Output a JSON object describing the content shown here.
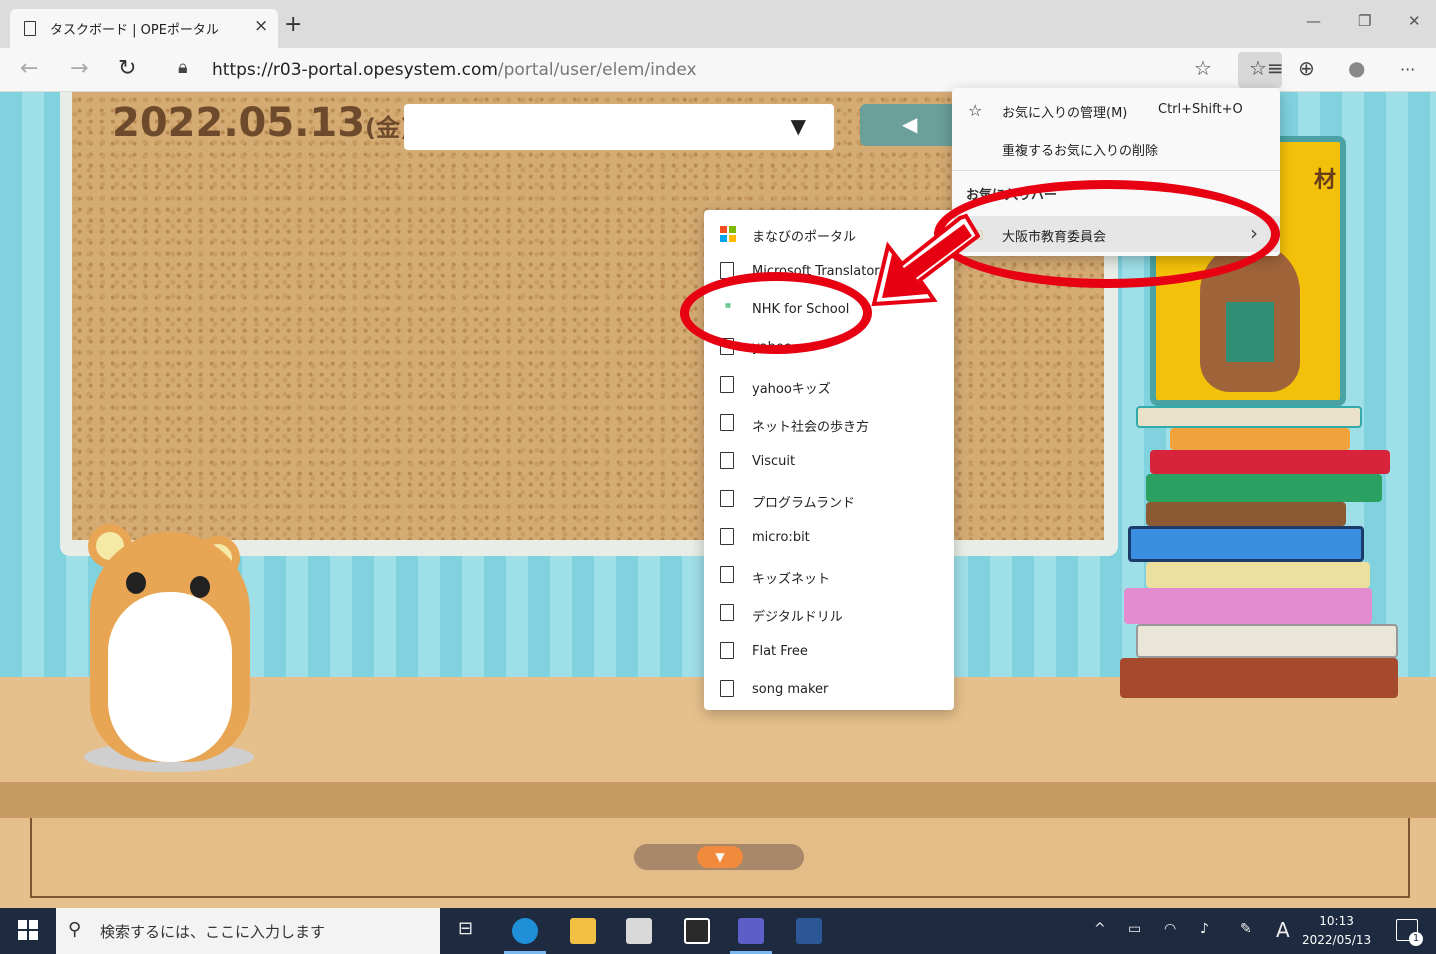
{
  "browser": {
    "tab_title": "タスクボード | OPEポータル",
    "tab_close": "×",
    "new_tab": "+",
    "url_host": "https://r03-portal.opesystem.com",
    "url_path": "/portal/user/elem/index",
    "window_min": "—",
    "window_restore": "❐",
    "window_close": "✕",
    "more": "···"
  },
  "page": {
    "date": "2022.05.13",
    "weekday": "(金)",
    "select_arrow": "▼",
    "prev_arrow": "◀",
    "drawer_arrow": "▼",
    "book_label": "材"
  },
  "favorites": {
    "manage_label": "お気に入りの管理(M)",
    "manage_shortcut": "Ctrl+Shift+O",
    "remove_dup_label": "重複するお気に入りの削除",
    "section_label": "お気に入りバー",
    "folder_label": "大阪市教育委員会",
    "chevron": "›"
  },
  "submenu": {
    "items": [
      {
        "label": "まなびのポータル"
      },
      {
        "label": "Microsoft Translator"
      },
      {
        "label": "NHK for School"
      },
      {
        "label": "yahoo"
      },
      {
        "label": "yahooキッズ"
      },
      {
        "label": "ネット社会の歩き方"
      },
      {
        "label": "Viscuit"
      },
      {
        "label": "プログラムランド"
      },
      {
        "label": "micro:bit"
      },
      {
        "label": "キッズネット"
      },
      {
        "label": "デジタルドリル"
      },
      {
        "label": "Flat Free"
      },
      {
        "label": "song maker"
      }
    ]
  },
  "taskbar": {
    "search_placeholder": "検索するには、ここに入力します",
    "time": "10:13",
    "date": "2022/05/13",
    "ime": "A",
    "notif_count": "1"
  }
}
